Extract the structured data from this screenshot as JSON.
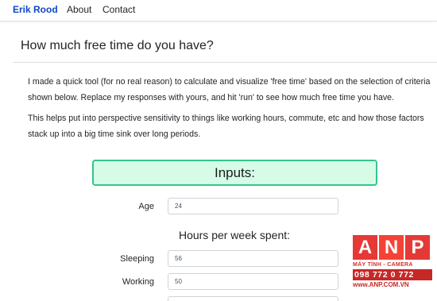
{
  "navbar": {
    "brand": "Erik Rood",
    "links": [
      "About",
      "Contact"
    ]
  },
  "main": {
    "title": "How much free time do you have?",
    "paragraphs": [
      "I made a quick tool (for no real reason) to calculate and visualize 'free time' based on the selection of criteria shown below. Replace my responses with yours, and hit 'run' to see how much free time you have.",
      "This helps put into perspective sensitivity to things like working hours, commute, etc and how those factors stack up into a big time sink over long periods."
    ],
    "inputs_heading": "Inputs:",
    "age": {
      "label": "Age",
      "value": "24"
    },
    "hours_heading": "Hours per week spent:",
    "fields": [
      {
        "label": "Sleeping",
        "value": "56"
      },
      {
        "label": "Working",
        "value": "50"
      }
    ]
  },
  "watermark": {
    "letters": [
      "A",
      "N",
      "P"
    ],
    "tagline": "MÁY TÍNH - CAMERA",
    "phone": "098 772 0 772",
    "website": "www.ANP.COM.VN"
  },
  "colors": {
    "brand": "#0d47c7",
    "inputs_box_bg": "#d6fce8",
    "inputs_box_border": "#33c58c",
    "watermark_red": "#e53935"
  }
}
